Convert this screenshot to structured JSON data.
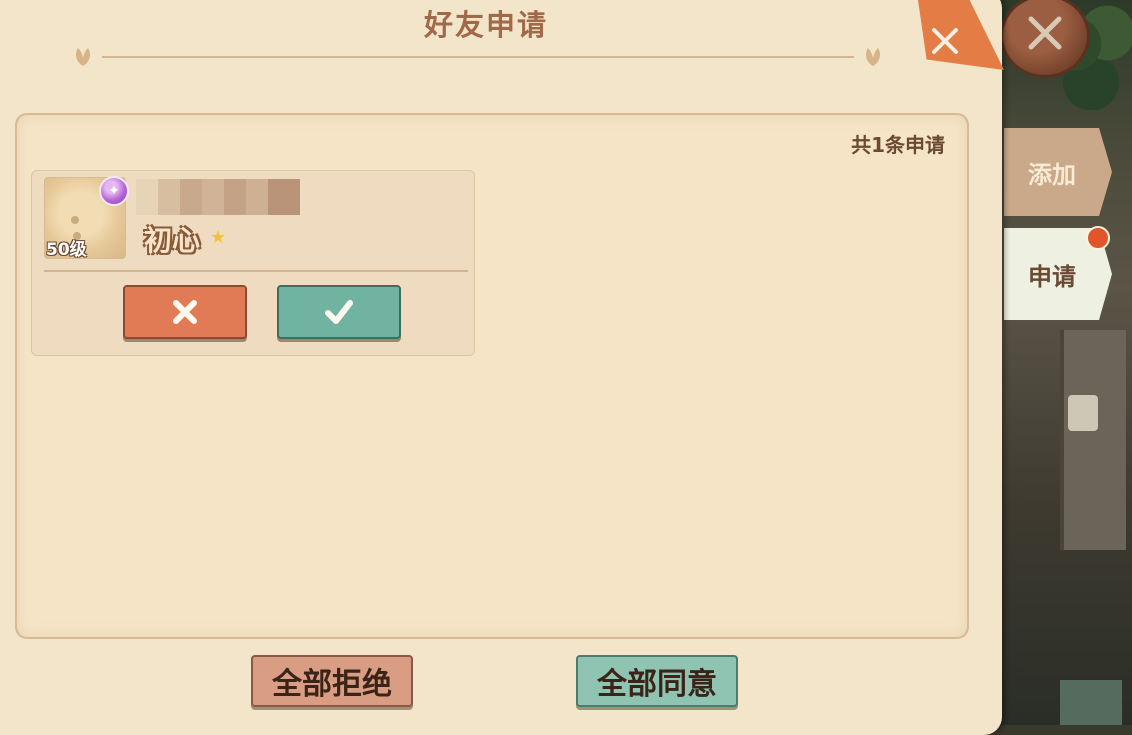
{
  "header": {
    "title": "好友申请"
  },
  "list": {
    "count_text": "共1条申请"
  },
  "requests": [
    {
      "level": "50级",
      "nickname": "初心"
    }
  ],
  "actions": {
    "reject_all": "全部拒绝",
    "accept_all": "全部同意"
  },
  "tabs": [
    {
      "label": "添加"
    },
    {
      "label": "申请"
    }
  ],
  "icons": {
    "reject": "x-icon",
    "accept": "checkmark-icon",
    "close": "close-icon",
    "badge": "sparkle-badge-icon",
    "star": "star-icon",
    "leaf": "leaf-ornament-icon"
  },
  "colors": {
    "title": "#a06a4a",
    "reject": "#e07b55",
    "accept": "#6fb3a0",
    "notification_dot": "#e0562a"
  }
}
